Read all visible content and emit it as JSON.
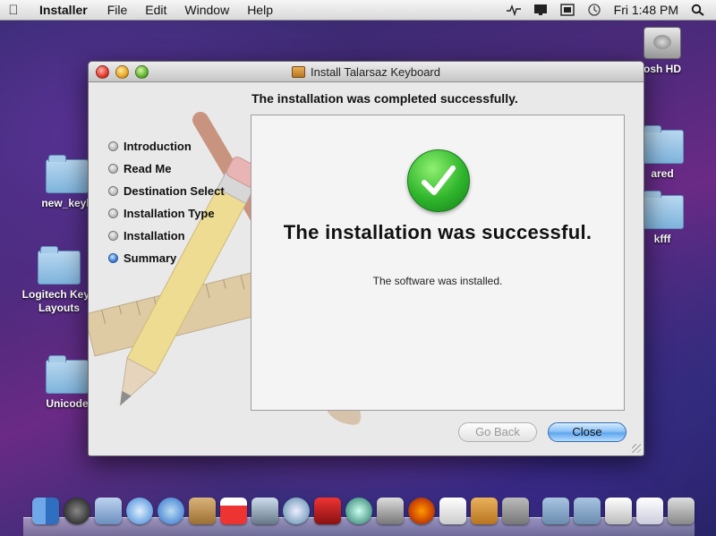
{
  "menubar": {
    "app_name": "Installer",
    "menus": [
      "File",
      "Edit",
      "Window",
      "Help"
    ],
    "clock": "Fri 1:48 PM"
  },
  "desktop": {
    "icons": [
      {
        "label": "new_keyb",
        "type": "folder"
      },
      {
        "label": "Logitech Keyb\nLayouts",
        "type": "folder"
      },
      {
        "label": "Unicode",
        "type": "folder"
      },
      {
        "label": "osh HD",
        "type": "hard-drive"
      },
      {
        "label": "ared",
        "type": "folder"
      },
      {
        "label": "kfff",
        "type": "folder"
      }
    ]
  },
  "window": {
    "title": "Install Talarsaz Keyboard",
    "header": "The installation was completed successfully.",
    "steps": [
      {
        "label": "Introduction",
        "active": false
      },
      {
        "label": "Read Me",
        "active": false
      },
      {
        "label": "Destination Select",
        "active": false
      },
      {
        "label": "Installation Type",
        "active": false
      },
      {
        "label": "Installation",
        "active": false
      },
      {
        "label": "Summary",
        "active": true
      }
    ],
    "success_title": "The installation was successful.",
    "success_detail": "The software was installed.",
    "back_label": "Go Back",
    "close_label": "Close"
  },
  "dock": {
    "apps": [
      "finder",
      "dashboard",
      "mail",
      "safari",
      "ichat",
      "address-book",
      "ical",
      "preview",
      "itunes",
      "photo-booth",
      "time-machine",
      "system-preferences",
      "firefox",
      "textedit",
      "installer",
      "downloads",
      "applications",
      "documents",
      "terminal",
      "mail-stack",
      "trash"
    ]
  },
  "colors": {
    "accent_blue": "#5ea6ee",
    "success_green": "#2fb52c"
  }
}
